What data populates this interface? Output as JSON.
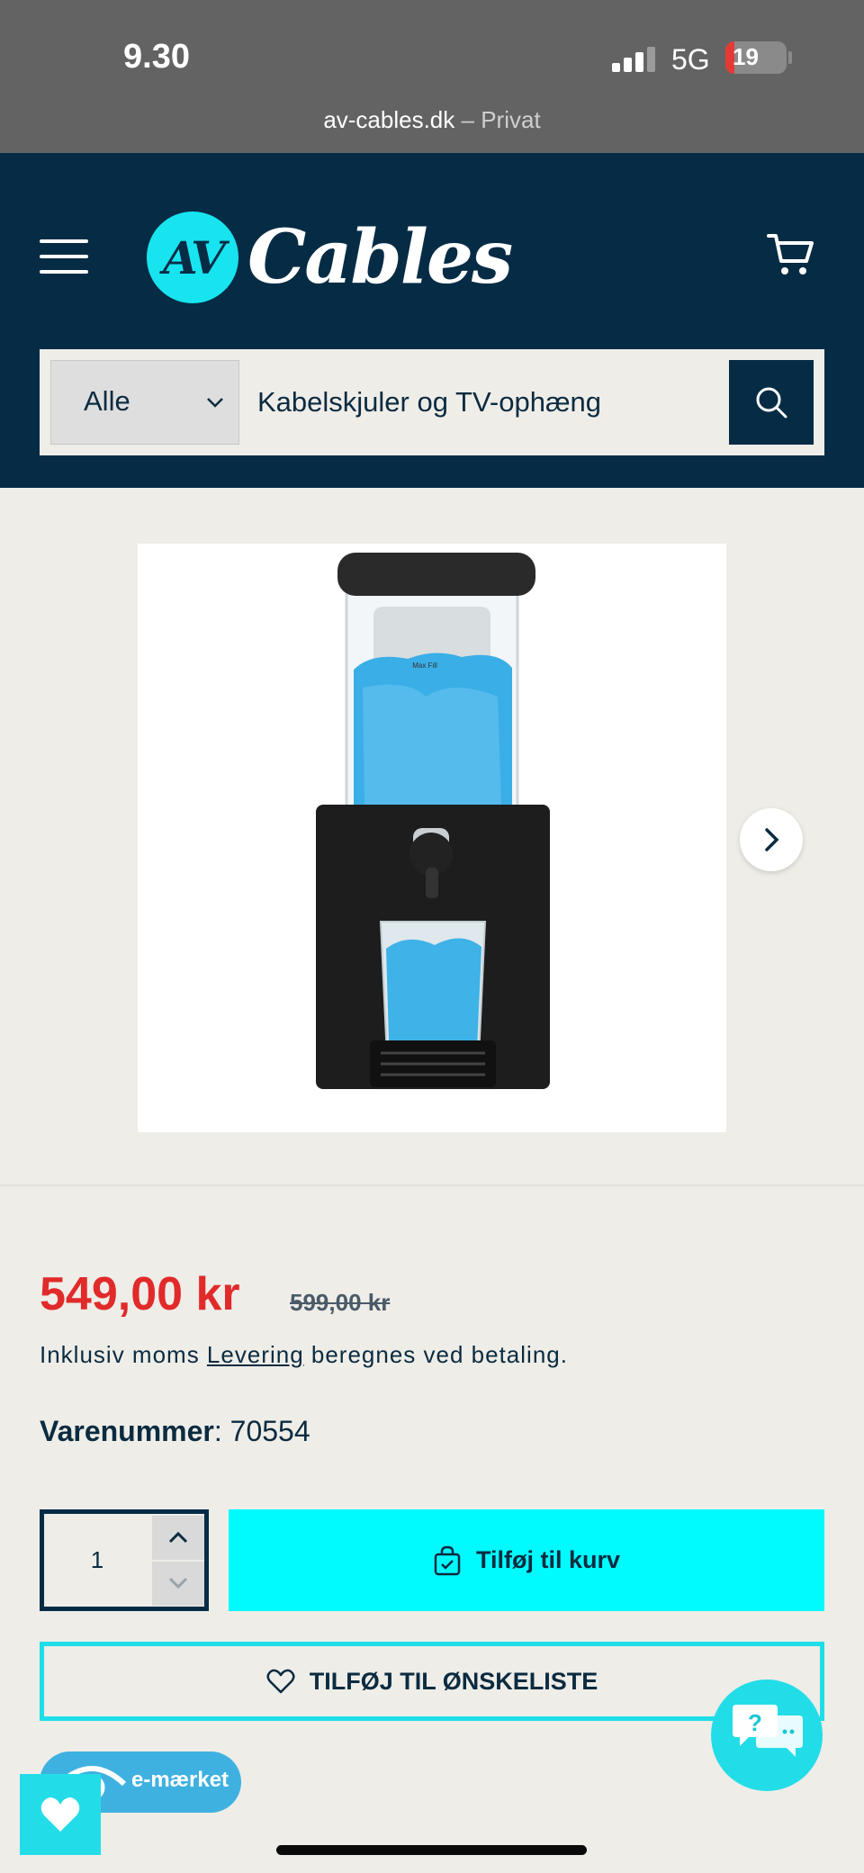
{
  "status_bar": {
    "time": "9.30",
    "network": "5G",
    "battery": "19",
    "url_domain": "av-cables.dk",
    "url_separator": " – ",
    "url_mode": "Privat"
  },
  "header": {
    "logo_mark": "AV",
    "logo_word": "Cables",
    "search": {
      "category": "Alle",
      "query": "Kabelskjuler og TV-ophæng"
    },
    "colors": {
      "background": "#062c45",
      "accent": "#17e4ef"
    }
  },
  "product": {
    "image_label": "Max Fill",
    "price": "549,00 kr",
    "old_price": "599,00 kr",
    "tax_prefix": "Inklusiv moms ",
    "tax_link": "Levering",
    "tax_suffix": " beregnes ved betaling.",
    "sku_label": "Varenummer",
    "sku_value": ": 70554",
    "quantity": "1",
    "add_to_cart": "Tilføj til kurv",
    "add_to_wishlist": "TILFØJ TIL ØNSKELISTE",
    "badge": "e-mærket",
    "colors": {
      "price": "#e12a2a",
      "cta": "#00fbff"
    }
  },
  "chat": {
    "glyph": "?"
  }
}
